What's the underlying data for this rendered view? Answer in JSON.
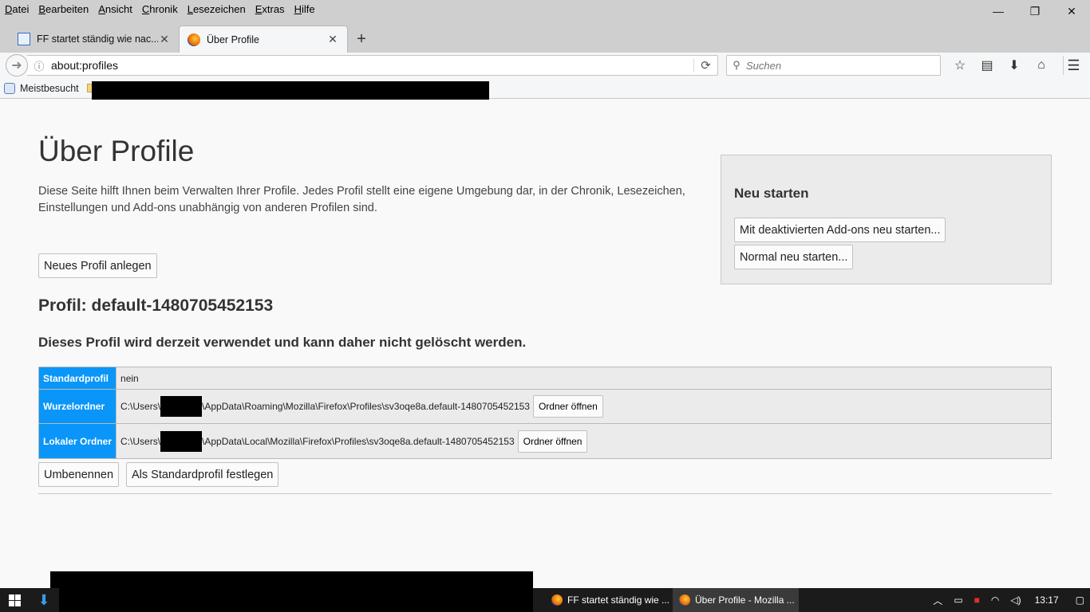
{
  "menubar": {
    "items": [
      "Datei",
      "Bearbeiten",
      "Ansicht",
      "Chronik",
      "Lesezeichen",
      "Extras",
      "Hilfe"
    ]
  },
  "window_controls": {
    "minimize": "—",
    "restore": "❐",
    "close": "✕"
  },
  "tabs": [
    {
      "title": "FF startet ständig wie nac...",
      "active": false,
      "close": "✕"
    },
    {
      "title": "Über Profile",
      "active": true,
      "close": "✕"
    }
  ],
  "newtab": "+",
  "navbar": {
    "url": "about:profiles",
    "search_placeholder": "Suchen"
  },
  "bookmarks": {
    "first": "Meistbesucht"
  },
  "page": {
    "title": "Über Profile",
    "intro": "Diese Seite hilft Ihnen beim Verwalten Ihrer Profile. Jedes Profil stellt eine eigene Umgebung dar, in der Chronik, Lesezeichen, Einstellungen und Add-ons unabhängig von anderen Profilen sind.",
    "new_profile_button": "Neues Profil anlegen",
    "restart": {
      "heading": "Neu starten",
      "disabled_addons_button": "Mit deaktivierten Add-ons neu starten...",
      "normal_button": "Normal neu starten..."
    },
    "profile": {
      "heading": "Profil: default-1480705452153",
      "in_use_note": "Dieses Profil wird derzeit verwendet und kann daher nicht gelöscht werden.",
      "rows": {
        "default_label": "Standardprofil",
        "default_value": "nein",
        "root_label": "Wurzelordner",
        "root_prefix": "C:\\Users\\",
        "root_suffix": "\\AppData\\Roaming\\Mozilla\\Firefox\\Profiles\\sv3oqe8a.default-1480705452153",
        "local_label": "Lokaler Ordner",
        "local_prefix": "C:\\Users\\",
        "local_suffix": "\\AppData\\Local\\Mozilla\\Firefox\\Profiles\\sv3oqe8a.default-1480705452153",
        "open_folder_button": "Ordner öffnen"
      },
      "rename_button": "Umbenennen",
      "set_default_button": "Als Standardprofil festlegen"
    }
  },
  "taskbar": {
    "items": [
      "FF startet ständig wie ...",
      "Über Profile - Mozilla ..."
    ],
    "clock": "13:17"
  }
}
